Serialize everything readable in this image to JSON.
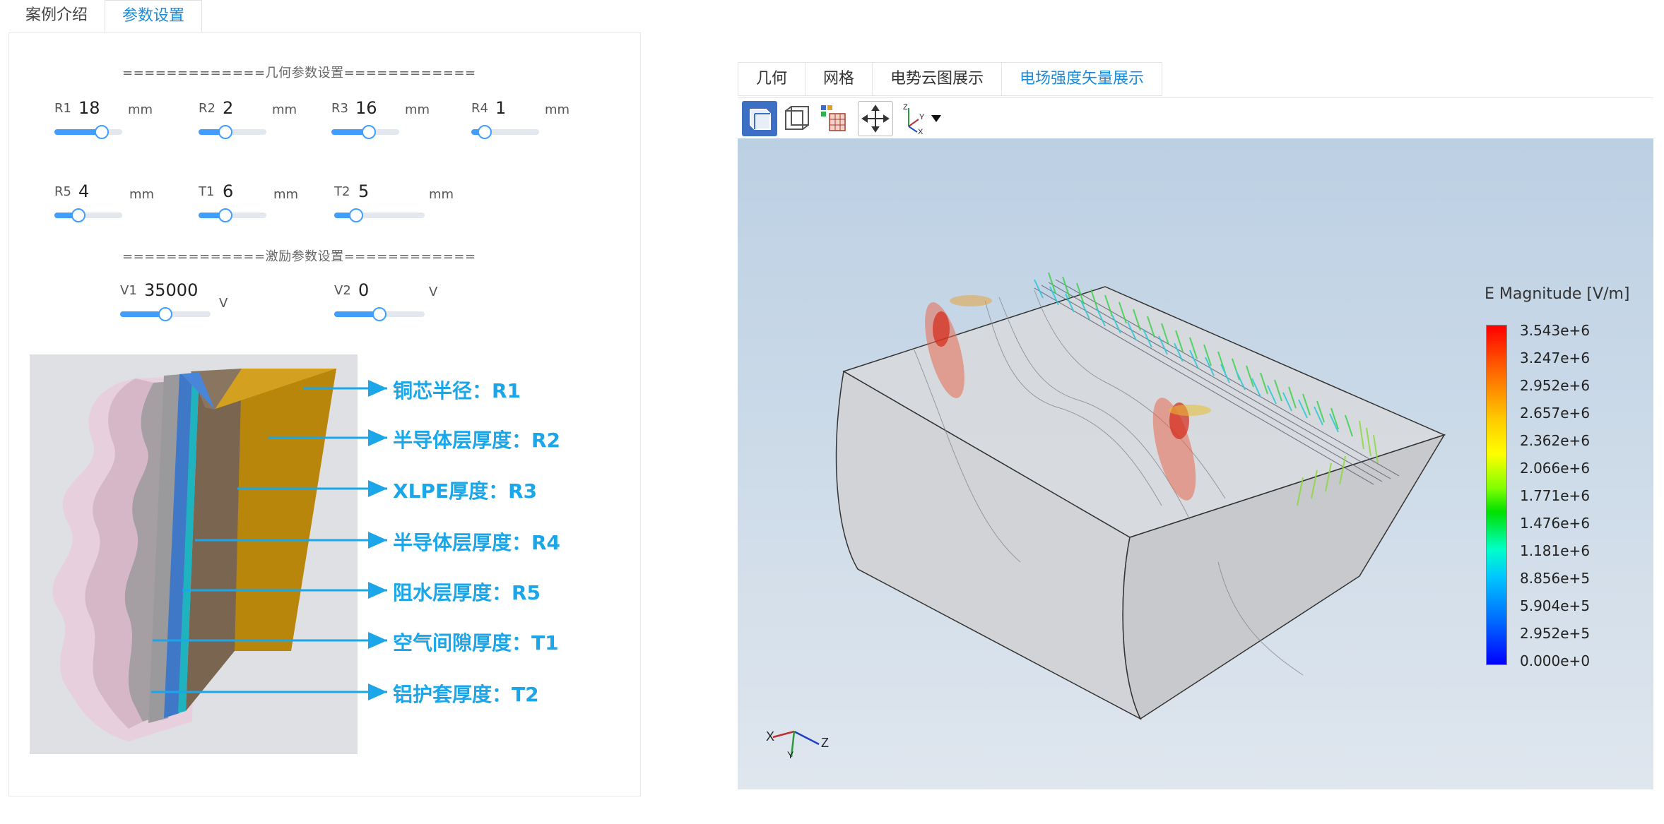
{
  "left_tabs": [
    {
      "label": "案例介绍",
      "active": false
    },
    {
      "label": "参数设置",
      "active": true
    }
  ],
  "geometry_section": "=============几何参数设置============",
  "excitation_section": "=============激励参数设置============",
  "geometry_params": [
    {
      "name": "R1",
      "value": "18",
      "unit": "mm",
      "slider": 0.7
    },
    {
      "name": "R2",
      "value": "2",
      "unit": "mm",
      "slider": 0.4
    },
    {
      "name": "R3",
      "value": "16",
      "unit": "mm",
      "slider": 0.55
    },
    {
      "name": "R4",
      "value": "1",
      "unit": "mm",
      "slider": 0.2
    },
    {
      "name": "R5",
      "value": "4",
      "unit": "mm",
      "slider": 0.35
    },
    {
      "name": "T1",
      "value": "6",
      "unit": "mm",
      "slider": 0.4
    },
    {
      "name": "T2",
      "value": "5",
      "unit": "mm",
      "slider": 0.24
    }
  ],
  "excitation_params": [
    {
      "name": "V1",
      "value": "35000",
      "unit": "V",
      "slider": 0.5
    },
    {
      "name": "V2",
      "value": "0",
      "unit": "V",
      "slider": 0.5
    }
  ],
  "diagram_labels": [
    "铜芯半径：R1",
    "半导体层厚度：R2",
    "XLPE厚度：R3",
    "半导体层厚度：R4",
    "阻水层厚度：R5",
    "空气间隙厚度：T1",
    "铝护套厚度：T2"
  ],
  "right_tabs": [
    {
      "label": "几何",
      "active": false
    },
    {
      "label": "网格",
      "active": false
    },
    {
      "label": "电势云图展示",
      "active": false
    },
    {
      "label": "电场强度矢量展示",
      "active": true
    }
  ],
  "toolbar": {
    "icons": [
      "solid-view-icon",
      "wireframe-view-icon",
      "colormap-view-icon",
      "fit-view-icon",
      "axis-orientation-icon"
    ]
  },
  "viewport": {
    "legend_title": "E Magnitude [V/m]",
    "legend_ticks": [
      "3.543e+6",
      "3.247e+6",
      "2.952e+6",
      "2.657e+6",
      "2.362e+6",
      "2.066e+6",
      "1.771e+6",
      "1.476e+6",
      "1.181e+6",
      "8.856e+5",
      "5.904e+5",
      "2.952e+5",
      "0.000e+0"
    ],
    "triad_labels": {
      "x": "X",
      "y": "Y",
      "z": "Z"
    },
    "toolbar_triad_labels": {
      "x": "X",
      "y": "Y",
      "z": "Z"
    }
  },
  "colors": {
    "accent": "#1b8ad8",
    "slider": "#409eff",
    "annotation": "#1aa6e8"
  }
}
